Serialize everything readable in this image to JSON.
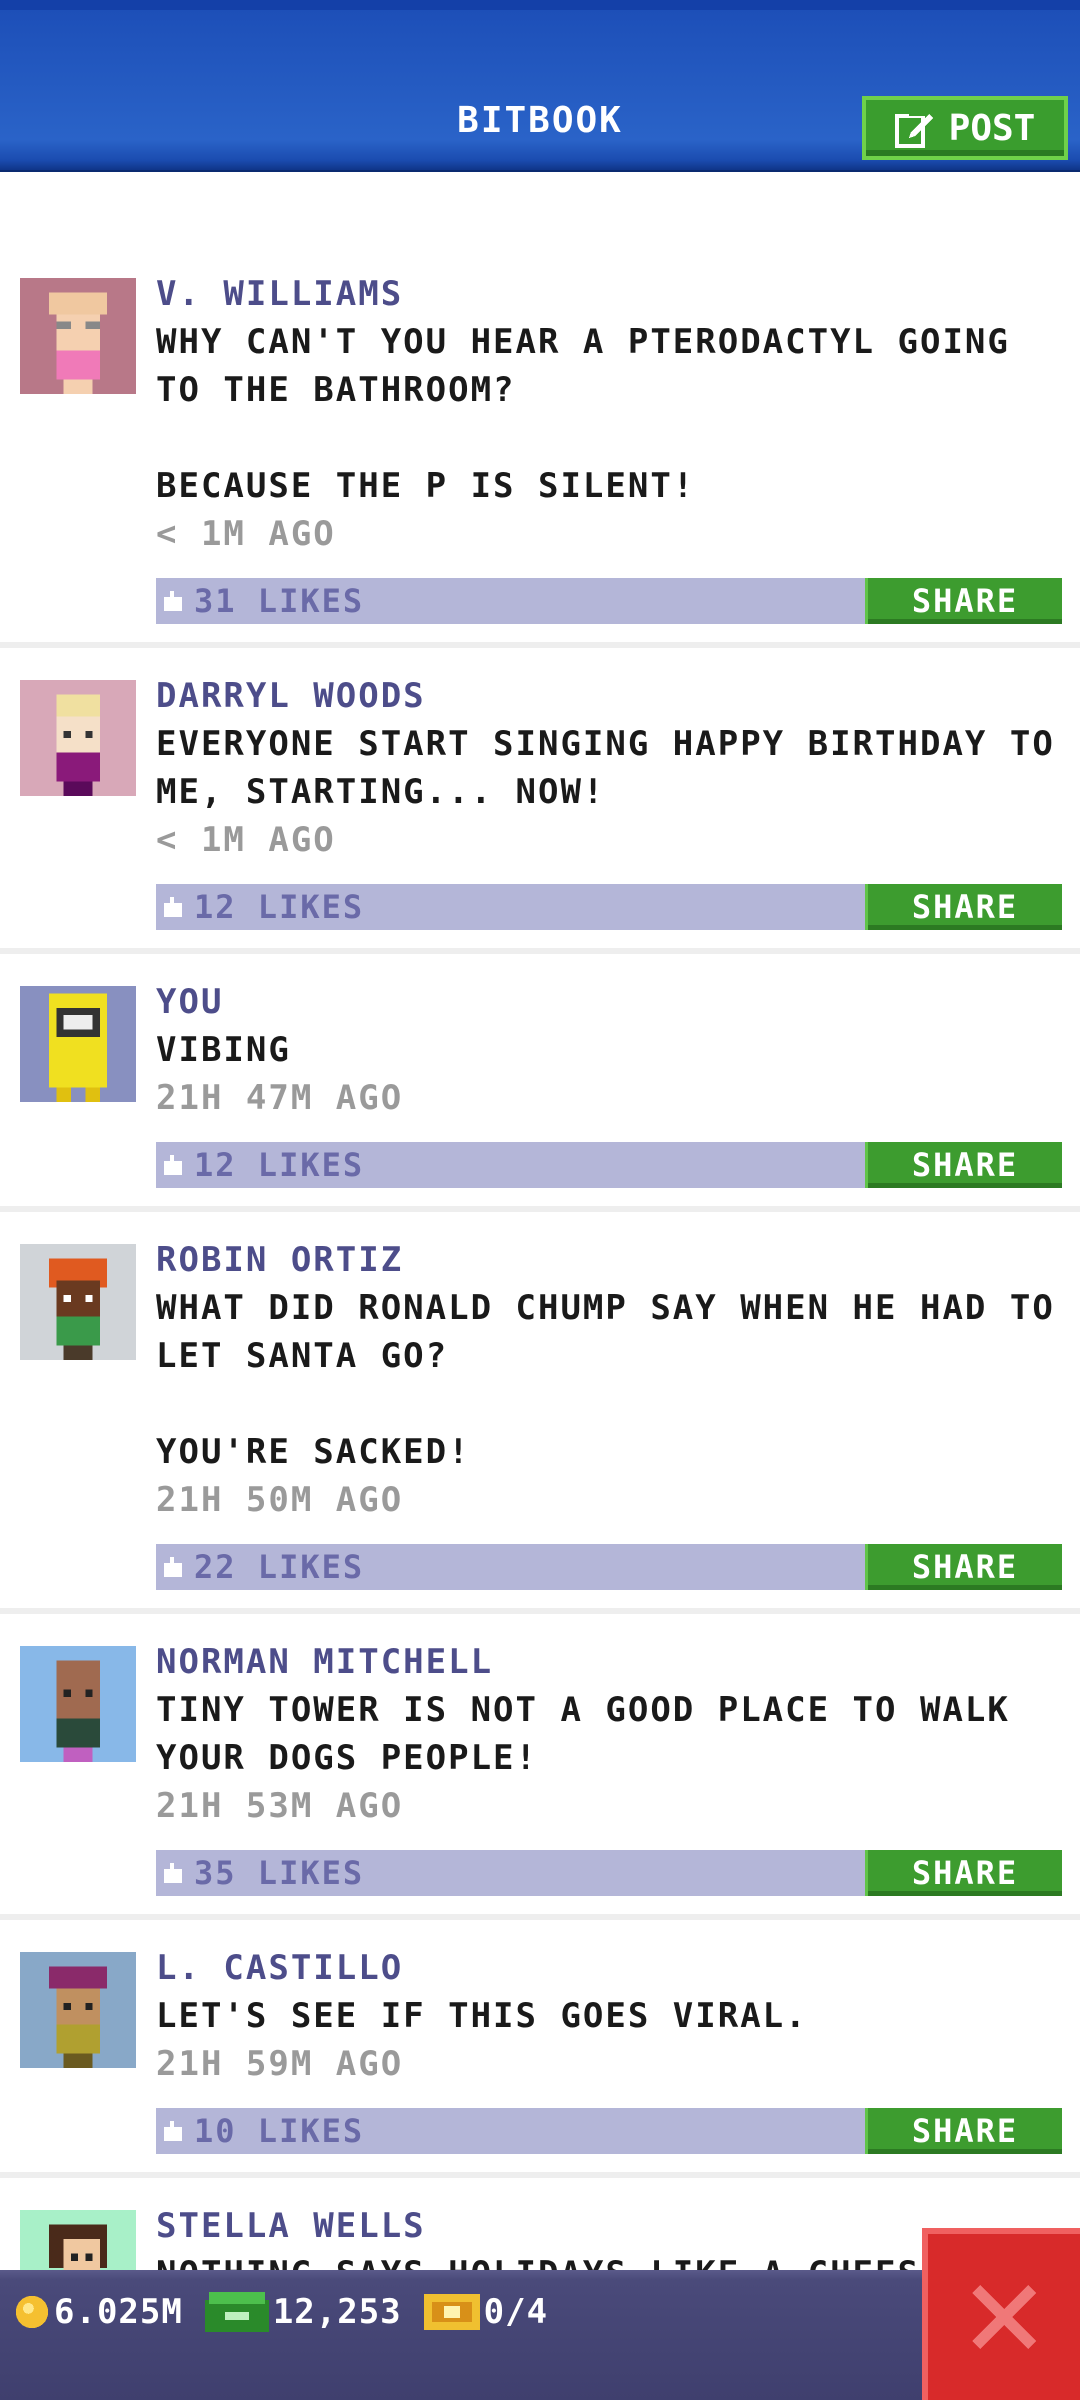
{
  "header": {
    "title": "BITBOOK",
    "post_label": "POST"
  },
  "posts": [
    {
      "author": "V. WILLIAMS",
      "text": "WHY CAN'T YOU HEAR A PTERODACTYL GOING TO THE BATHROOM?\n\nBECAUSE THE P IS SILENT!",
      "time": "< 1M AGO",
      "likes": "31 LIKES",
      "share": "SHARE",
      "avatar_bg": "#b87888",
      "avatar": "glasses-woman-avatar"
    },
    {
      "author": "DARRYL WOODS",
      "text": "EVERYONE START SINGING HAPPY BIRTHDAY TO ME, STARTING... NOW!",
      "time": "< 1M AGO",
      "likes": "12 LIKES",
      "share": "SHARE",
      "avatar_bg": "#d8a8b8",
      "avatar": "blonde-man-avatar"
    },
    {
      "author": "YOU",
      "text": "VIBING",
      "time": "21H 47M AGO",
      "likes": "12 LIKES",
      "share": "SHARE",
      "avatar_bg": "#8890c0",
      "avatar": "hazmat-avatar"
    },
    {
      "author": "ROBIN ORTIZ",
      "text": "WHAT DID RONALD CHUMP SAY WHEN HE HAD TO LET SANTA GO?\n\nYOU'RE SACKED!",
      "time": "21H 50M AGO",
      "likes": "22 LIKES",
      "share": "SHARE",
      "avatar_bg": "#d0d4d8",
      "avatar": "redhead-avatar"
    },
    {
      "author": "NORMAN MITCHELL",
      "text": "TINY TOWER IS NOT A GOOD PLACE TO WALK YOUR DOGS PEOPLE!",
      "time": "21H 53M AGO",
      "likes": "35 LIKES",
      "share": "SHARE",
      "avatar_bg": "#88b8e8",
      "avatar": "bald-man-avatar"
    },
    {
      "author": "L. CASTILLO",
      "text": "LET'S SEE IF THIS GOES VIRAL.",
      "time": "21H 59M AGO",
      "likes": "10 LIKES",
      "share": "SHARE",
      "avatar_bg": "#88a8c8",
      "avatar": "cap-man-avatar"
    },
    {
      "author": "STELLA WELLS",
      "text": "NOTHING SAYS HOLIDAYS LIKE A CHEESE LOG.",
      "time": "",
      "likes": "",
      "share": "",
      "avatar_bg": "#a8f0c8",
      "avatar": "brunette-woman-avatar"
    }
  ],
  "footer": {
    "coins": "6.025M",
    "bux": "12,253",
    "tickets": "0/4"
  },
  "colors": {
    "header_blue": "#1d4fb8",
    "share_green": "#3d9c2f",
    "close_red": "#d82a2a",
    "like_bar": "#b4b6d8"
  }
}
